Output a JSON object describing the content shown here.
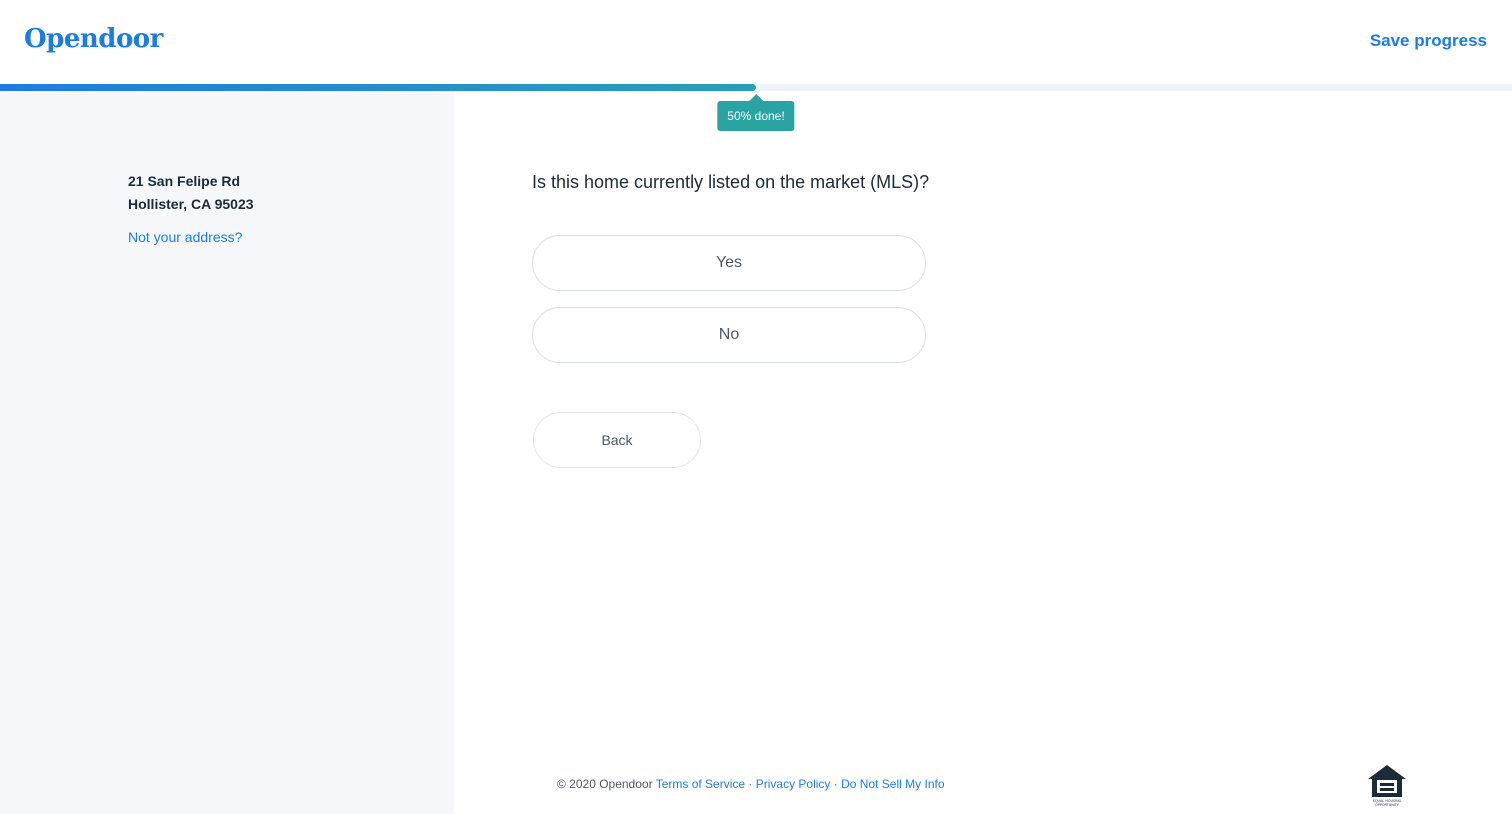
{
  "header": {
    "logo": "Opendoor",
    "save_label": "Save progress"
  },
  "progress": {
    "percent": 50,
    "label": "50% done!"
  },
  "sidebar": {
    "address_line1": "21 San Felipe Rd",
    "address_line2": "Hollister, CA 95023",
    "not_address_link": "Not your address?"
  },
  "main": {
    "question": "Is this home currently listed on the market (MLS)?",
    "options": [
      "Yes",
      "No"
    ],
    "back_label": "Back"
  },
  "footer": {
    "copyright": "© 2020  Opendoor",
    "terms": "Terms of Service",
    "privacy": "Privacy Policy",
    "do_not_sell": "Do Not Sell My Info",
    "separator": "·",
    "eho_text": "EQUAL HOUSING OPPORTUNITY"
  },
  "colors": {
    "brand": "#1c7ce3",
    "progress_end": "#27a0b6",
    "tooltip": "#2aa3a3",
    "sidebar_bg": "#f5f7fb"
  }
}
